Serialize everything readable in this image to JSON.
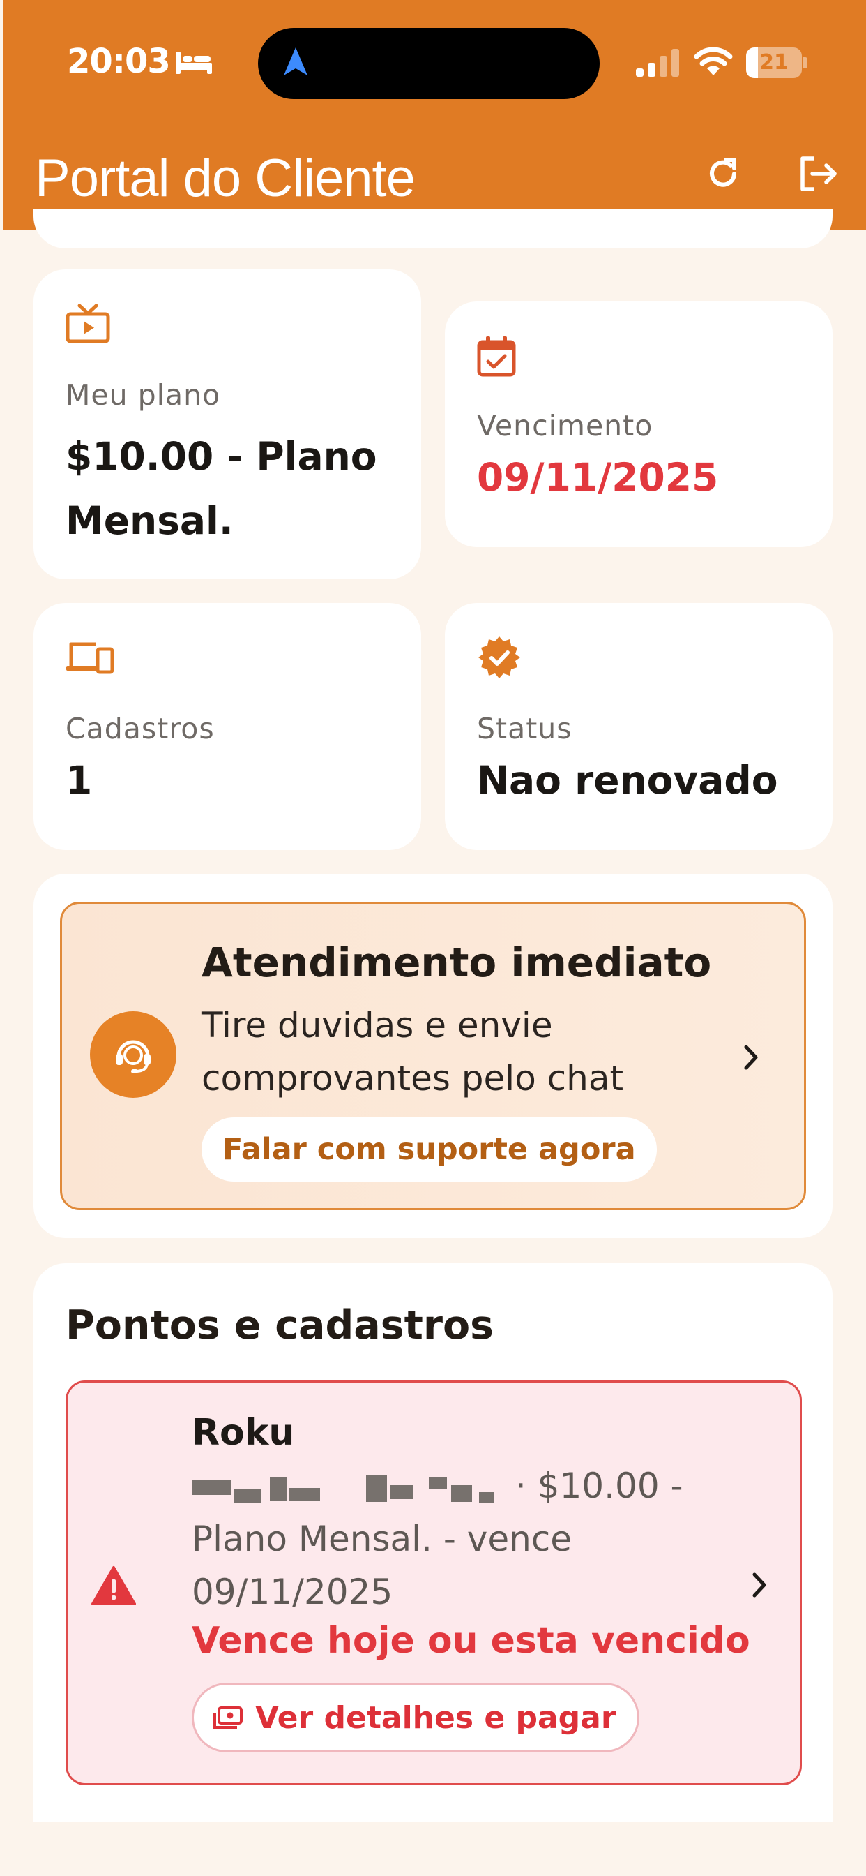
{
  "status_bar": {
    "time": "20:03",
    "battery": "21",
    "battery_level": 0.21
  },
  "header": {
    "title": "Portal do Cliente",
    "refresh_icon": "refresh-icon",
    "logout_icon": "logout-icon",
    "background_color": "#e07b24"
  },
  "stats": {
    "plan": {
      "label": "Meu plano",
      "value": "$10.00 - Plano Mensal.",
      "icon": "tv-icon"
    },
    "due": {
      "label": "Vencimento",
      "value": "09/11/2025",
      "icon": "calendar-check-icon",
      "value_color": "#e2383e"
    },
    "registrations": {
      "label": "Cadastros",
      "value": "1",
      "icon": "devices-icon"
    },
    "status": {
      "label": "Status",
      "value": "Nao renovado",
      "icon": "verified-badge-icon"
    }
  },
  "support": {
    "title": "Atendimento imediato",
    "text": "Tire duvidas e envie comprovantes pelo chat",
    "button": "Falar com suporte agora",
    "icon": "support-agent-icon"
  },
  "points": {
    "title": "Pontos e cadastros",
    "device": {
      "name": "Roku",
      "description_rest": " · $10.00 - Plano Mensal. - vence 09/11/2025",
      "alert": "Vence hoje ou esta vencido",
      "button": "Ver detalhes e pagar",
      "icon": "warning-icon"
    }
  }
}
